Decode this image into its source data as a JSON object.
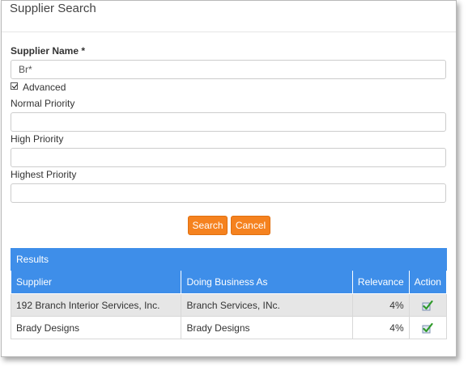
{
  "dialog": {
    "title": "Supplier Search"
  },
  "form": {
    "supplier_name_label": "Supplier Name *",
    "supplier_name_value": "Br*",
    "advanced_label": "Advanced",
    "normal_priority_label": "Normal Priority",
    "normal_priority_value": "",
    "high_priority_label": "High Priority",
    "high_priority_value": "",
    "highest_priority_label": "Highest Priority",
    "highest_priority_value": ""
  },
  "buttons": {
    "search": "Search",
    "cancel": "Cancel"
  },
  "results": {
    "header": "Results",
    "columns": [
      "Supplier",
      "Doing Business As",
      "Relevance",
      "Action"
    ],
    "rows": [
      {
        "supplier": "192 Branch Interior Services, Inc.",
        "dba": "Branch Services, INc.",
        "relevance": "4%",
        "action_icon": "select-check-icon"
      },
      {
        "supplier": "Brady Designs",
        "dba": "Brady Designs",
        "relevance": "4%",
        "action_icon": "select-check-icon"
      }
    ]
  },
  "colors": {
    "accent": "#f5821f",
    "header": "#3e8ee9"
  }
}
